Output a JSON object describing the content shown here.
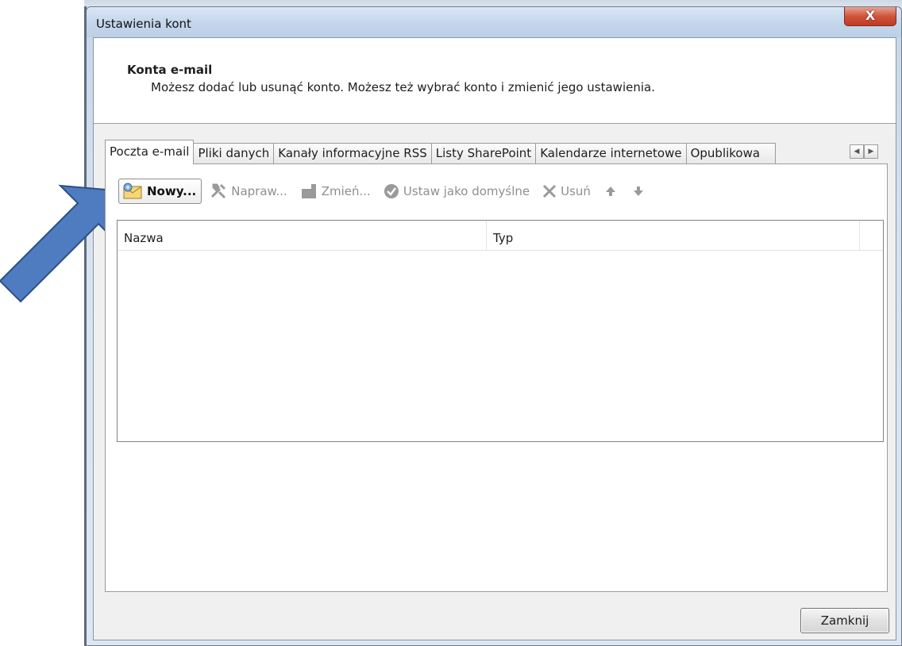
{
  "window": {
    "title": "Ustawienia kont",
    "close_glyph": "X"
  },
  "header": {
    "title": "Konta e-mail",
    "description": "Możesz dodać lub usunąć konto. Możesz też wybrać konto i zmienić jego ustawienia."
  },
  "tabs": [
    {
      "label": "Poczta e-mail",
      "active": true
    },
    {
      "label": "Pliki danych"
    },
    {
      "label": "Kanały informacyjne RSS"
    },
    {
      "label": "Listy SharePoint"
    },
    {
      "label": "Kalendarze internetowe"
    },
    {
      "label": "Opublikowa"
    }
  ],
  "toolbar": {
    "new_label": "Nowy...",
    "repair_label": "Napraw...",
    "change_label": "Zmień...",
    "default_label": "Ustaw jako domyślne",
    "remove_label": "Usuń"
  },
  "list": {
    "columns": [
      "Nazwa",
      "Typ"
    ]
  },
  "footer": {
    "close_label": "Zamknij"
  },
  "colors": {
    "arrow_fill": "#4f7bc0",
    "arrow_stroke": "#2e4f86",
    "close_button": "#c9462d"
  },
  "icons": {
    "new": "envelope-new-icon",
    "repair": "tools-icon",
    "change": "folder-change-icon",
    "default": "check-circle-icon",
    "remove": "x-delete-icon",
    "up": "arrow-up-icon",
    "down": "arrow-down-icon"
  }
}
